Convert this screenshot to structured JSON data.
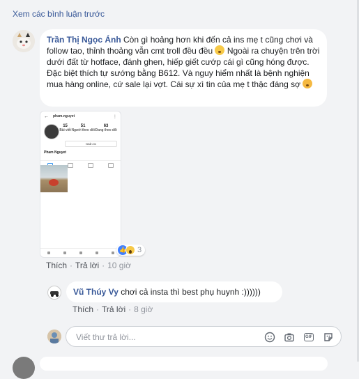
{
  "view_previous": "Xem các bình luận trước",
  "comment": {
    "author": "Trần Thị Ngọc Ánh",
    "text_1": " Còn gì hoảng hơn khi đến cả ins mẹ t cũng chơi và follow tao, thỉnh thoảng vẫn cmt troll đều đều ",
    "text_2": " Ngoài ra chuyện trên trời dưới đất từ hotface, đánh ghen, hiếp giết cướp cái gì cũng hóng được. Đặc biệt thích tự sướng bằng B612. Và nguy hiểm nhất là bệnh nghiện mua hàng online, cứ sale lại vợt. Cái sự xì tin của mẹ t thậc đáng sợ ",
    "emoji_1": "grimacing-face-emoji",
    "emoji_2": "crying-face-emoji",
    "screenshot": {
      "username": "pham.nguyet",
      "stats": [
        {
          "value": "15",
          "label": "Bài viết"
        },
        {
          "value": "51",
          "label": "Người theo dõi"
        },
        {
          "value": "63",
          "label": "Đang theo dõi"
        }
      ],
      "edit_label": "Nhắn tin",
      "display_name": "Pham Nguyet"
    },
    "reactions": {
      "count": "3",
      "types": [
        "like-icon",
        "wow-icon"
      ]
    },
    "actions": {
      "like": "Thích",
      "reply": "Trả lời",
      "time": "10 giờ"
    }
  },
  "reply": {
    "author": "Vũ Thúy Vy",
    "text": " chơi cả insta thì best phụ huynh :))))))",
    "actions": {
      "like": "Thích",
      "reply": "Trả lời",
      "time": "8 giờ"
    }
  },
  "reply_input": {
    "placeholder": "Viết thư trả lời...",
    "icons": [
      "emoji-icon",
      "camera-icon",
      "gif-icon",
      "sticker-icon"
    ]
  },
  "colors": {
    "link": "#385898",
    "background": "#f2f3f5",
    "bubble": "#ffffff"
  }
}
